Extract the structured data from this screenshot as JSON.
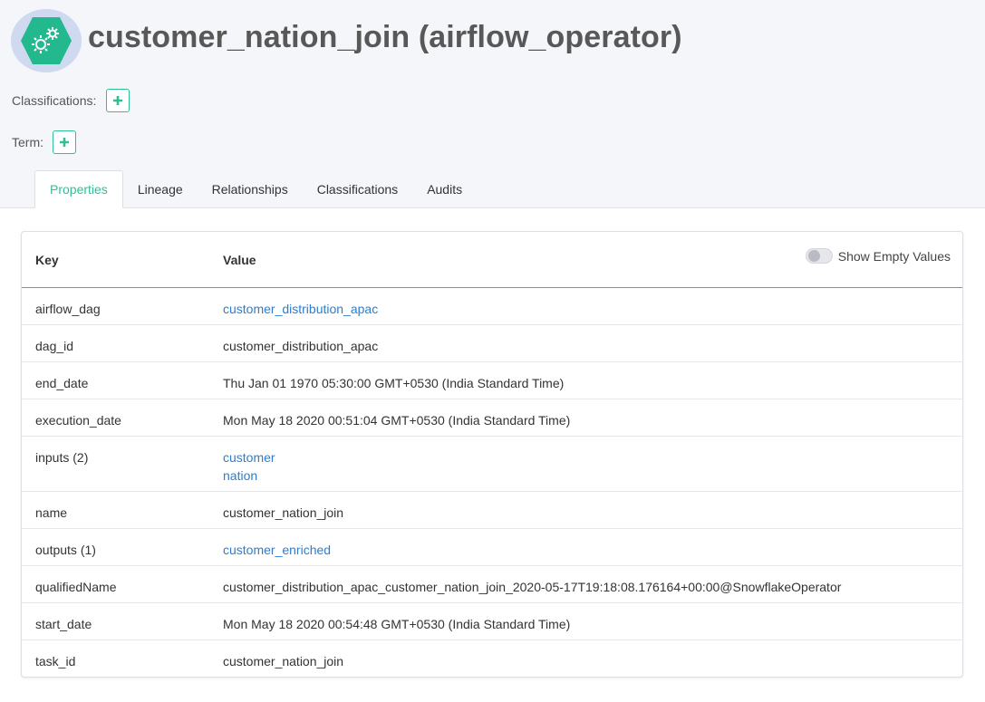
{
  "entity": {
    "icon": "gear-hexagon-icon",
    "title": "customer_nation_join (airflow_operator)"
  },
  "meta": {
    "classifications_label": "Classifications:",
    "term_label": "Term:"
  },
  "tabs": [
    {
      "label": "Properties",
      "active": true
    },
    {
      "label": "Lineage",
      "active": false
    },
    {
      "label": "Relationships",
      "active": false
    },
    {
      "label": "Classifications",
      "active": false
    },
    {
      "label": "Audits",
      "active": false
    }
  ],
  "table": {
    "key_header": "Key",
    "value_header": "Value",
    "toggle_label": "Show Empty Values",
    "toggle_on": false,
    "rows": [
      {
        "key": "airflow_dag",
        "values": [
          "customer_distribution_apac"
        ],
        "link": true
      },
      {
        "key": "dag_id",
        "values": [
          "customer_distribution_apac"
        ],
        "link": false
      },
      {
        "key": "end_date",
        "values": [
          "Thu Jan 01 1970 05:30:00 GMT+0530 (India Standard Time)"
        ],
        "link": false
      },
      {
        "key": "execution_date",
        "values": [
          "Mon May 18 2020 00:51:04 GMT+0530 (India Standard Time)"
        ],
        "link": false
      },
      {
        "key": "inputs (2)",
        "values": [
          "customer",
          "nation"
        ],
        "link": true
      },
      {
        "key": "name",
        "values": [
          "customer_nation_join"
        ],
        "link": false
      },
      {
        "key": "outputs (1)",
        "values": [
          "customer_enriched"
        ],
        "link": true
      },
      {
        "key": "qualifiedName",
        "values": [
          "customer_distribution_apac_customer_nation_join_2020-05-17T19:18:08.176164+00:00@SnowflakeOperator"
        ],
        "link": false
      },
      {
        "key": "start_date",
        "values": [
          "Mon May 18 2020 00:54:48 GMT+0530 (India Standard Time)"
        ],
        "link": false
      },
      {
        "key": "task_id",
        "values": [
          "customer_nation_join"
        ],
        "link": false
      }
    ]
  },
  "colors": {
    "accent": "#2fbf95",
    "link": "#2a7ed2",
    "icon_bg": "#cfd9ef",
    "icon_fill": "#24b88e"
  }
}
